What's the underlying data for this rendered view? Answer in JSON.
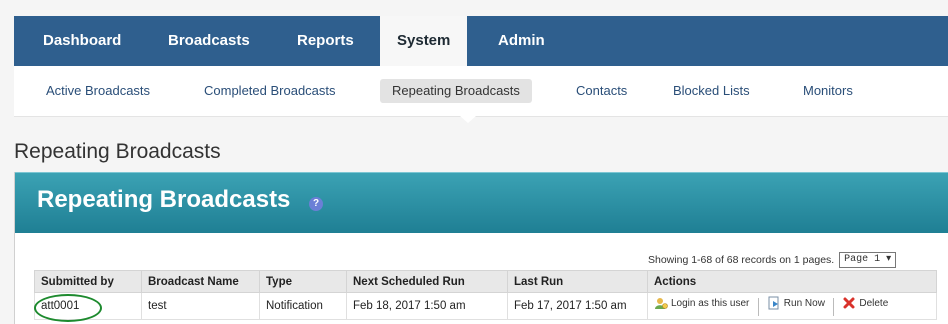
{
  "topnav": {
    "tabs": [
      {
        "label": "Dashboard"
      },
      {
        "label": "Broadcasts"
      },
      {
        "label": "Reports"
      },
      {
        "label": "System"
      },
      {
        "label": "Admin"
      }
    ]
  },
  "subnav": {
    "items": [
      {
        "label": "Active Broadcasts"
      },
      {
        "label": "Completed Broadcasts"
      },
      {
        "label": "Repeating Broadcasts"
      },
      {
        "label": "Contacts"
      },
      {
        "label": "Blocked Lists"
      },
      {
        "label": "Monitors"
      }
    ]
  },
  "page": {
    "heading": "Repeating Broadcasts",
    "panel_title": "Repeating Broadcasts",
    "help_icon": "?"
  },
  "table": {
    "records_text": "Showing 1-68 of 68 records on 1 pages.",
    "page_select": "Page 1",
    "headers": [
      "Submitted by",
      "Broadcast Name",
      "Type",
      "Next Scheduled Run",
      "Last Run",
      "Actions"
    ],
    "rows": [
      {
        "submitted_by": "att0001",
        "broadcast_name": "test",
        "type": "Notification",
        "next_run": "Feb 18, 2017 1:50 am",
        "last_run": "Feb 17, 2017 1:50 am",
        "actions": {
          "login": "Login as this user",
          "run_now": "Run Now",
          "delete": "Delete"
        }
      }
    ]
  },
  "colors": {
    "topnav_bg": "#2f5f8e",
    "panel_header": "#2a93a8",
    "annotation_oval": "#1d8a2e"
  }
}
